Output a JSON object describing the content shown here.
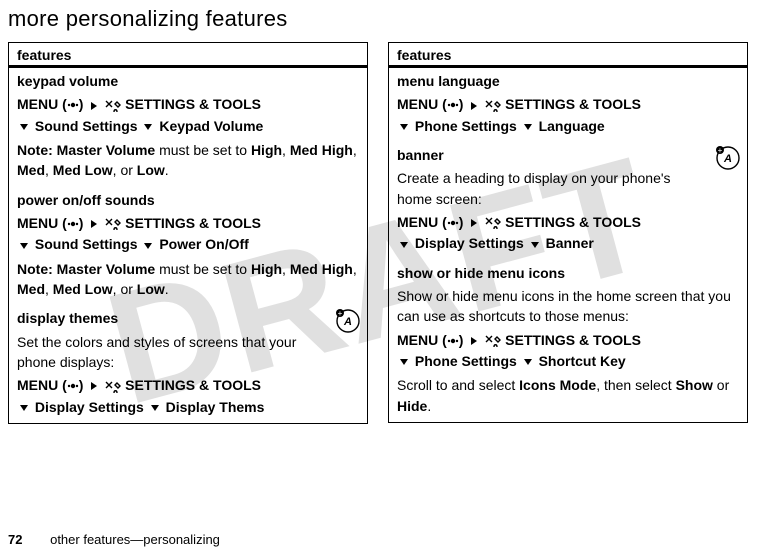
{
  "watermark": "DRAFT",
  "heading": "more personalizing features",
  "left": {
    "header": "features",
    "rows": [
      {
        "title": "keypad volume",
        "menu_prefix": "MENU",
        "menu_tail": "SETTINGS & TOOLS",
        "path_a": "Sound Settings",
        "path_b": "Keypad Volume",
        "note_label": "Note:",
        "note_a": " Master Volume",
        "note_b": " must be set to ",
        "opts": [
          "High",
          "Med High",
          "Med",
          "Med Low",
          "Low"
        ],
        "note_end": "."
      },
      {
        "title": "power on/off sounds",
        "menu_prefix": "MENU",
        "menu_tail": "SETTINGS & TOOLS",
        "path_a": "Sound Settings",
        "path_b": "Power On/Off",
        "note_label": "Note:",
        "note_a": " Master Volume",
        "note_b": " must be set to ",
        "opts": [
          "High",
          "Med High",
          "Med",
          "Med Low",
          "Low"
        ],
        "note_end": "."
      },
      {
        "title": "display themes",
        "desc": "Set the colors and styles of screens that your phone displays:",
        "menu_prefix": "MENU",
        "menu_tail": "SETTINGS & TOOLS",
        "path_a": "Display Settings",
        "path_b": "Display Thems",
        "badge": true
      }
    ]
  },
  "right": {
    "header": "features",
    "rows": [
      {
        "title": "menu language",
        "menu_prefix": "MENU",
        "menu_tail": "SETTINGS & TOOLS",
        "path_a": "Phone Settings",
        "path_b": "Language"
      },
      {
        "title": "banner",
        "desc": "Create a heading to display on your phone's home screen:",
        "menu_prefix": "MENU",
        "menu_tail": "SETTINGS & TOOLS",
        "path_a": "Display Settings",
        "path_b": "Banner",
        "badge": true
      },
      {
        "title": "show or hide menu icons",
        "desc": "Show or hide menu icons in the home screen that you can use as shortcuts to those menus:",
        "menu_prefix": "MENU",
        "menu_tail": "SETTINGS & TOOLS",
        "path_a": "Phone Settings",
        "path_b": "Shortcut Key",
        "tail_a": "Scroll to and select ",
        "tail_b": "Icons Mode",
        "tail_c": ", then select ",
        "tail_d": "Show",
        "tail_e": " or ",
        "tail_f": "Hide",
        "tail_g": "."
      }
    ]
  },
  "footer": {
    "page": "72",
    "text": "other features—personalizing"
  }
}
